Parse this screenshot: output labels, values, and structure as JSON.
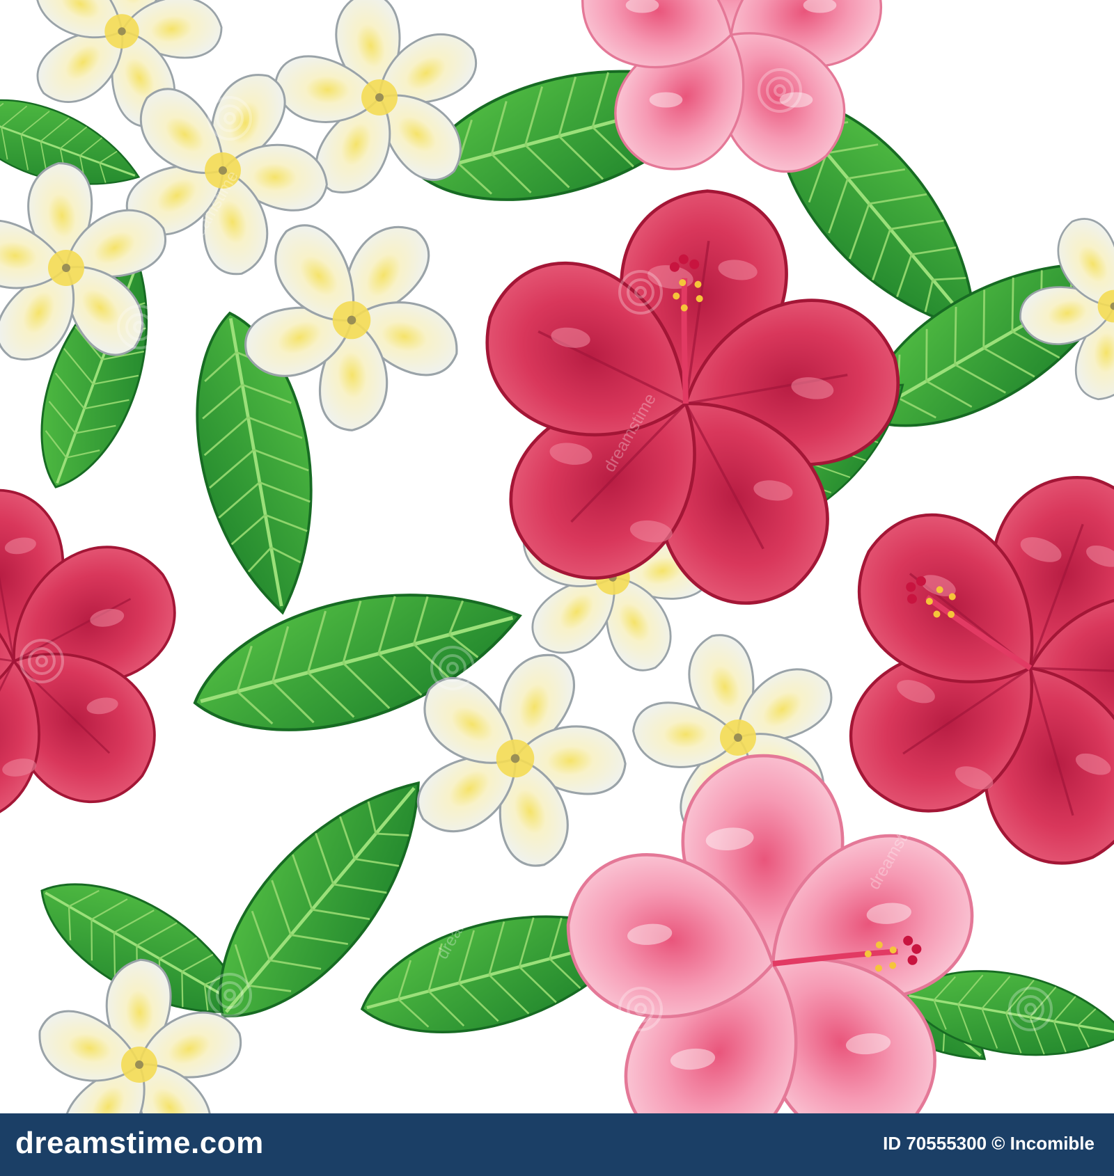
{
  "footer": {
    "brand": "dreamstime.com",
    "credit": "ID 70555300 © Incomible"
  },
  "watermark": {
    "text": "dreamstime",
    "icon": "dreamstime-spiral-icon"
  },
  "colors": {
    "background": "#ffffff",
    "footer": "#1b3f66",
    "leaf_dark": "#1f8a2e",
    "leaf_light": "#45b43c",
    "hibiscus_red": "#d8385a",
    "hibiscus_pink": "#f7a6bd",
    "plumeria_white": "#f1f4f6",
    "plumeria_yellow": "#f3df63"
  }
}
